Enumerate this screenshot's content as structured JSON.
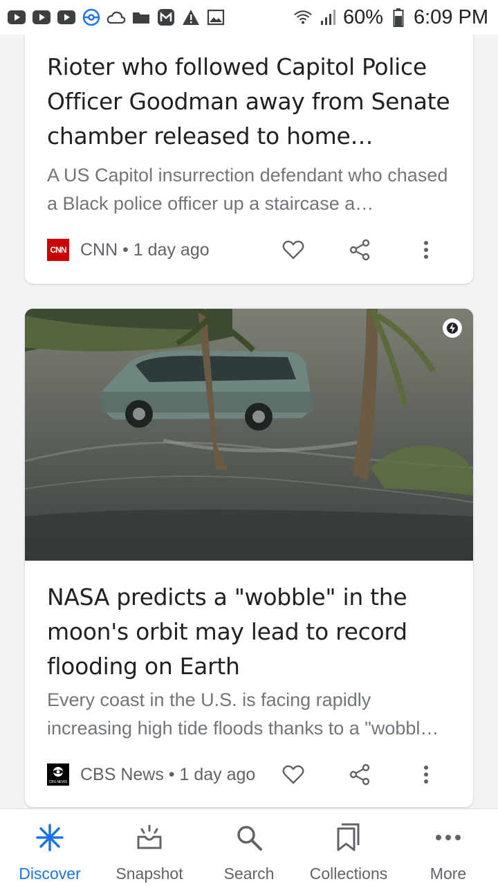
{
  "status_bar": {
    "icons_left": [
      "youtube-icon",
      "youtube-icon",
      "youtube-icon",
      "pokeball-icon",
      "cloud-icon",
      "folder-icon",
      "mail-icon",
      "warning-icon",
      "image-icon"
    ],
    "icons_right": [
      "wifi-icon",
      "signal-icon",
      "battery-icon"
    ],
    "battery": "60%",
    "time": "6:09 PM"
  },
  "cards": [
    {
      "title": "Rioter who followed Capitol Police Officer Goodman away from Senate chamber released to home…",
      "snippet": "A US Capitol insurrection defendant who chased a Black police officer up a staircase a…",
      "source_logo_text": "CNN",
      "source_meta": "CNN • 1 day ago"
    },
    {
      "title": "NASA predicts a \"wobble\" in the moon's orbit may lead to record flooding on Earth",
      "snippet": "Every coast in the U.S. is facing rapidly increasing high tide floods thanks to a \"wobbl…",
      "source_logo_text": "CBS NEWS",
      "source_meta": "CBS News • 1 day ago",
      "has_amp_badge": true
    }
  ],
  "bottom_nav": {
    "items": [
      {
        "label": "Discover",
        "icon": "asterisk-icon",
        "active": true
      },
      {
        "label": "Snapshot",
        "icon": "snapshot-icon",
        "active": false
      },
      {
        "label": "Search",
        "icon": "search-icon",
        "active": false
      },
      {
        "label": "Collections",
        "icon": "bookmarks-icon",
        "active": false
      },
      {
        "label": "More",
        "icon": "more-horiz-icon",
        "active": false
      }
    ]
  },
  "colors": {
    "accent": "#1a73e8",
    "text_primary": "#202124",
    "text_secondary": "#70757a"
  }
}
